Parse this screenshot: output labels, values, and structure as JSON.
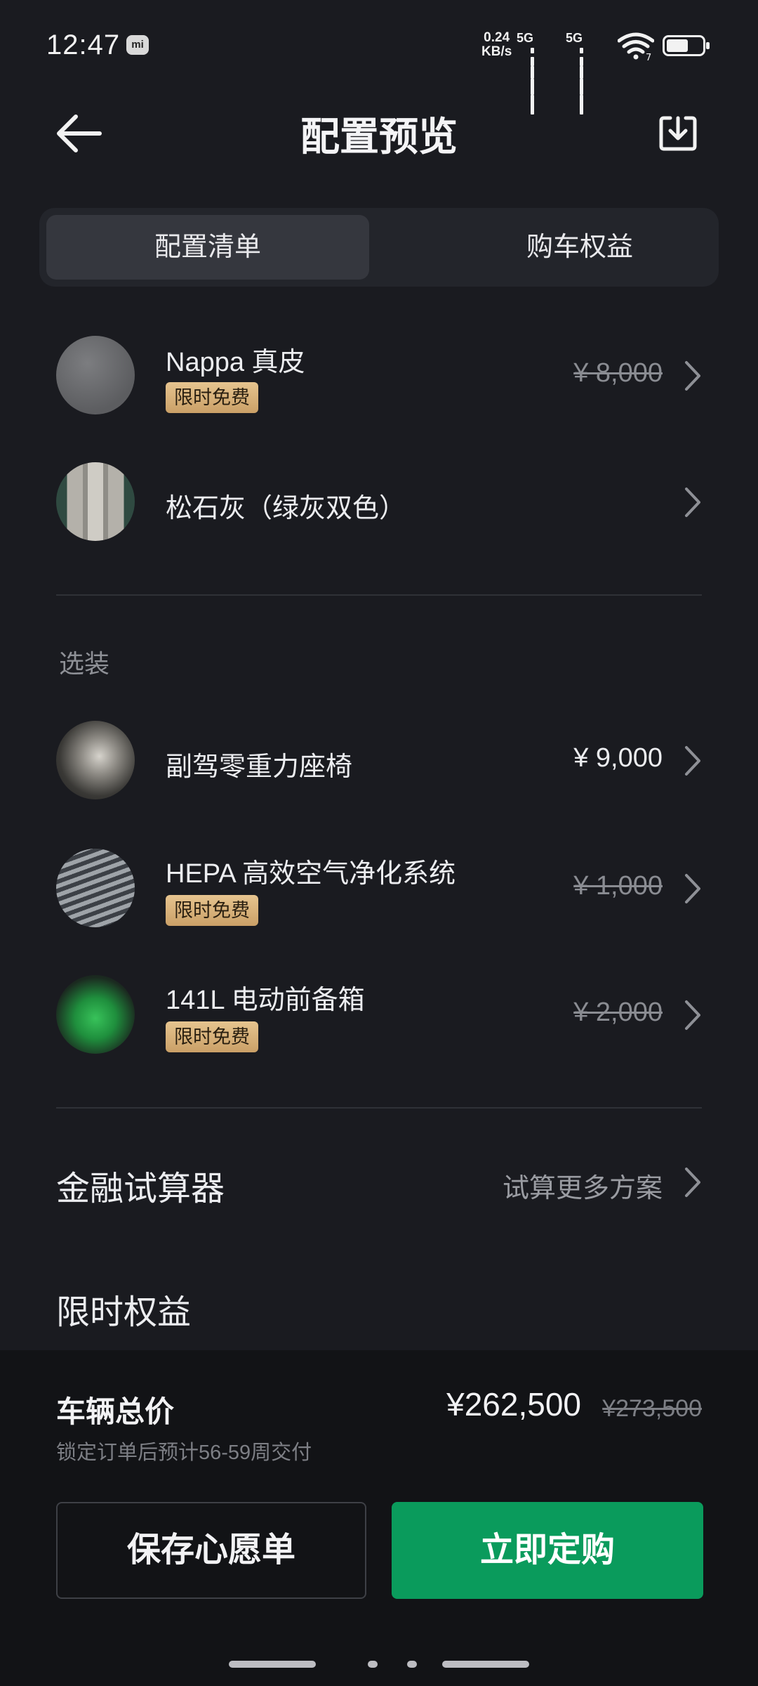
{
  "status_bar": {
    "time": "12:47",
    "mi_label": "mi",
    "net_speed_value": "0.24",
    "net_speed_unit": "KB/s",
    "sim1": "5G",
    "sim2": "5G",
    "wifi_sub": "7"
  },
  "header": {
    "title": "配置预览",
    "back_icon": "arrow-left-icon",
    "download_icon": "download-icon"
  },
  "tabs": [
    {
      "label": "配置清单",
      "active": true
    },
    {
      "label": "购车权益",
      "active": false
    }
  ],
  "base_items": [
    {
      "title": "Nappa 真皮",
      "badge": "限时免费",
      "price": "¥ 8,000",
      "struck": true,
      "thumb": "leather-swatch"
    },
    {
      "title": "松石灰（绿灰双色）",
      "badge": "",
      "price": "",
      "struck": false,
      "thumb": "seat-color-swatch"
    }
  ],
  "options_label": "选装",
  "options": [
    {
      "title": "副驾零重力座椅",
      "badge": "",
      "price": "¥ 9,000",
      "struck": false,
      "thumb": "seat-photo"
    },
    {
      "title": "HEPA 高效空气净化系统",
      "badge": "限时免费",
      "price": "¥ 1,000",
      "struck": true,
      "thumb": "filter-photo"
    },
    {
      "title": "141L 电动前备箱",
      "badge": "限时免费",
      "price": "¥ 2,000",
      "struck": true,
      "thumb": "car-frunk-photo"
    }
  ],
  "finance": {
    "title": "金融试算器",
    "link": "试算更多方案"
  },
  "limited_benefits": "限时权益",
  "summary": {
    "label": "车辆总价",
    "price": "¥262,500",
    "original_price": "¥273,500",
    "delivery_note": "锁定订单后预计56-59周交付"
  },
  "buttons": {
    "wishlist": "保存心愿单",
    "order": "立即定购"
  },
  "colors": {
    "background": "#1a1b20",
    "accent_green": "#0a9b5c",
    "badge_gold": "#caa067"
  }
}
